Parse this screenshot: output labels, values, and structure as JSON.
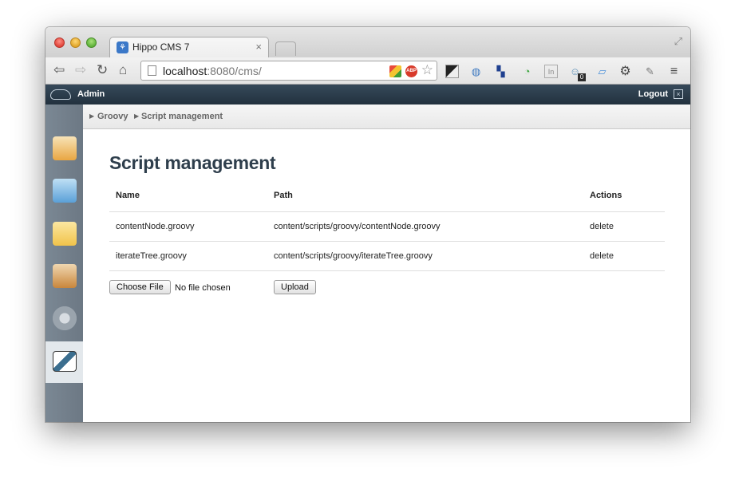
{
  "browser": {
    "tab_title": "Hippo CMS 7",
    "tab_close": "×",
    "url_host": "localhost",
    "url_path": ":8080/cms/",
    "abp_badge": "ABP",
    "ext_badge": "0"
  },
  "cms": {
    "user_label": "Admin",
    "logout_label": "Logout",
    "breadcrumbs": [
      "Groovy",
      "Script management"
    ],
    "sidebar": [
      {
        "icon": "home-icon",
        "color": "#e9a642"
      },
      {
        "icon": "images-icon",
        "color": "#5aa0d8"
      },
      {
        "icon": "folder-icon",
        "color": "#f1c34a"
      },
      {
        "icon": "clipboard-report-icon",
        "color": "#c9863c"
      },
      {
        "icon": "gear-icon",
        "color": "#9aa4ad"
      },
      {
        "icon": "groovy-logo-icon",
        "color": "#3b6e8f",
        "active": true
      }
    ]
  },
  "page": {
    "title": "Script management",
    "table": {
      "headers": [
        "Name",
        "Path",
        "Actions"
      ],
      "rows": [
        {
          "name": "contentNode.groovy",
          "path": "content/scripts/groovy/contentNode.groovy",
          "action": "delete"
        },
        {
          "name": "iterateTree.groovy",
          "path": "content/scripts/groovy/iterateTree.groovy",
          "action": "delete"
        }
      ]
    },
    "choose_file_label": "Choose File",
    "no_file_text": "No file chosen",
    "upload_label": "Upload"
  }
}
